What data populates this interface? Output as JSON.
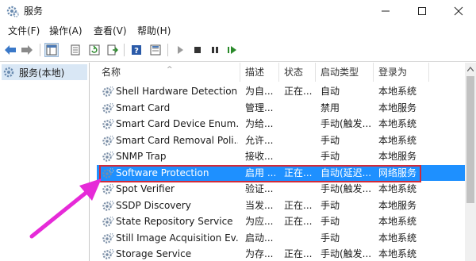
{
  "window": {
    "title": "服务",
    "controls": {
      "minimize": "—",
      "maximize": "☐",
      "close": "✕"
    }
  },
  "menu": {
    "items": [
      {
        "label": "文件(F)"
      },
      {
        "label": "操作(A)"
      },
      {
        "label": "查看(V)"
      },
      {
        "label": "帮助(H)"
      }
    ]
  },
  "toolbar": {
    "icons": [
      "back-icon",
      "forward-icon",
      "show-hide-console-tree-icon",
      "properties-icon",
      "refresh-icon",
      "export-list-icon",
      "help-icon",
      "view-icon",
      "start-service-icon",
      "stop-service-icon",
      "pause-service-icon",
      "restart-service-icon"
    ]
  },
  "tree": {
    "selected_label": "服务(本地)"
  },
  "table": {
    "columns": {
      "name": "名称",
      "description": "描述",
      "status": "状态",
      "startup": "启动类型",
      "logon": "登录为"
    },
    "rows": [
      {
        "name": "Shell Hardware Detection",
        "description": "为自...",
        "status": "正在...",
        "startup": "自动",
        "logon": "本地系统"
      },
      {
        "name": "Smart Card",
        "description": "管理...",
        "status": "",
        "startup": "禁用",
        "logon": "本地服务"
      },
      {
        "name": "Smart Card Device Enum...",
        "description": "为给...",
        "status": "",
        "startup": "手动(触发...",
        "logon": "本地系统"
      },
      {
        "name": "Smart Card Removal Poli...",
        "description": "允许...",
        "status": "",
        "startup": "手动",
        "logon": "本地系统"
      },
      {
        "name": "SNMP Trap",
        "description": "接收...",
        "status": "",
        "startup": "手动",
        "logon": "本地服务"
      },
      {
        "name": "Software Protection",
        "description": "启用 ...",
        "status": "正在...",
        "startup": "自动(延迟...",
        "logon": "网络服务"
      },
      {
        "name": "Spot Verifier",
        "description": "验证...",
        "status": "",
        "startup": "手动(触发...",
        "logon": "本地系统"
      },
      {
        "name": "SSDP Discovery",
        "description": "当发...",
        "status": "正在...",
        "startup": "手动",
        "logon": "本地服务"
      },
      {
        "name": "State Repository Service",
        "description": "为应...",
        "status": "正在...",
        "startup": "手动",
        "logon": "本地系统"
      },
      {
        "name": "Still Image Acquisition Ev...",
        "description": "启动...",
        "status": "",
        "startup": "手动",
        "logon": "本地系统"
      },
      {
        "name": "Storage Service",
        "description": "为存...",
        "status": "正在...",
        "startup": "手动(触发...",
        "logon": "本地系统"
      }
    ],
    "selected_index": 5
  },
  "colors": {
    "selection": "#1e90ff",
    "highlight_border": "#d12a39",
    "annotation_arrow": "#e62ad8",
    "tree_selection": "#d9e7f5"
  }
}
